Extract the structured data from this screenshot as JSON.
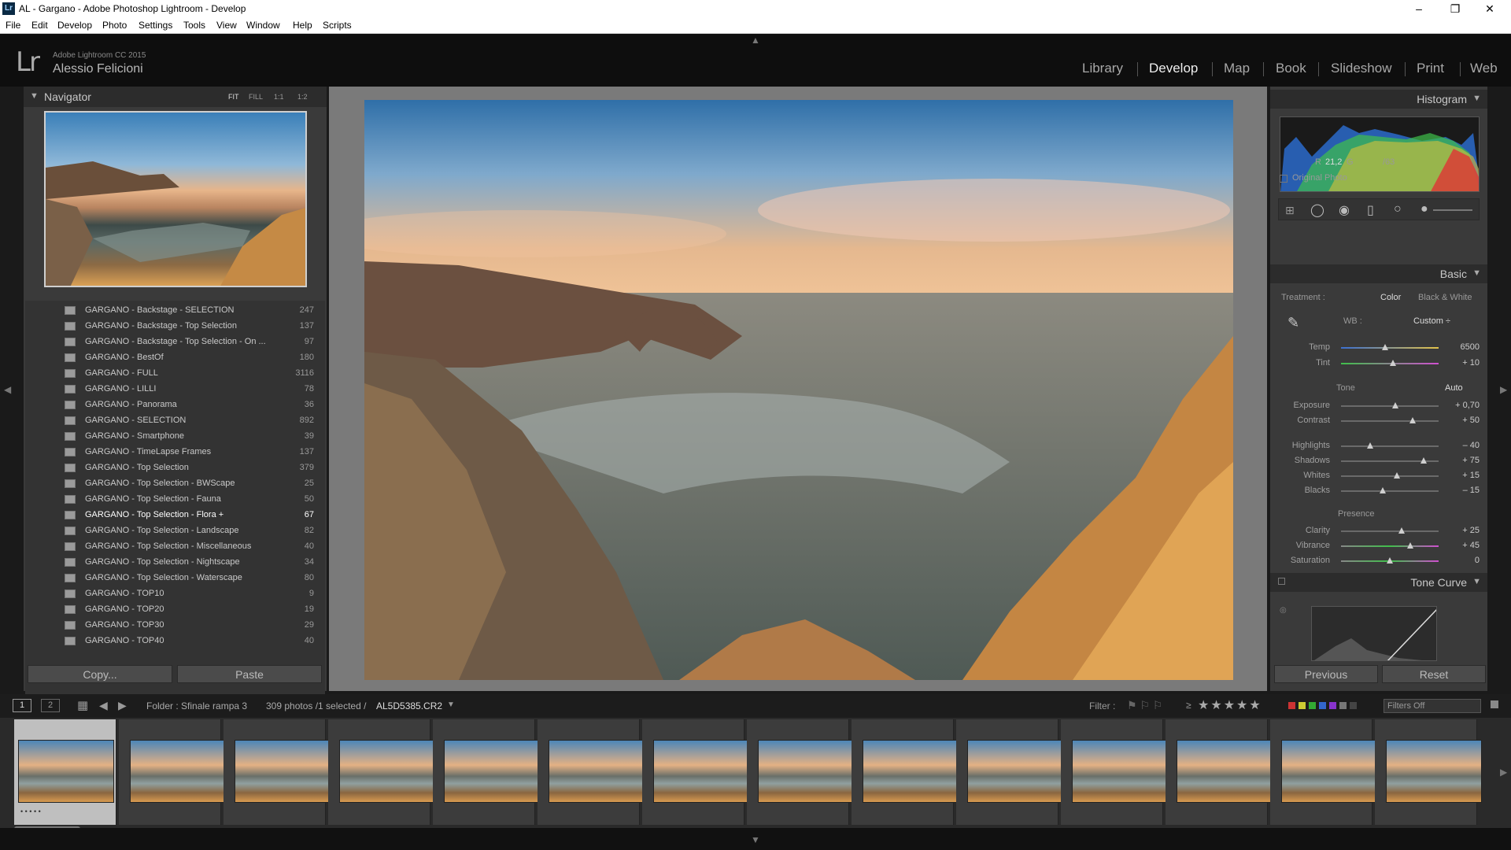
{
  "window": {
    "title": "AL - Gargano - Adobe Photoshop Lightroom - Develop",
    "icon": "Lr",
    "controls": {
      "minimize": "–",
      "maximize": "❐",
      "close": "✕"
    }
  },
  "menu": [
    "File",
    "Edit",
    "Develop",
    "Photo",
    "Settings",
    "Tools",
    "View",
    "Window",
    "Help",
    "Scripts"
  ],
  "header": {
    "logo": "Lr",
    "app_version": "Adobe Lightroom CC 2015",
    "user": "Alessio Felicioni",
    "modules": [
      "Library",
      "Develop",
      "Map",
      "Book",
      "Slideshow",
      "Print",
      "Web"
    ],
    "active_module": "Develop"
  },
  "navigator": {
    "title": "Navigator",
    "options": [
      "FIT",
      "FILL",
      "1:1",
      "1:2"
    ]
  },
  "collections": [
    {
      "name": "GARGANO - Backstage - SELECTION",
      "count": "247"
    },
    {
      "name": "GARGANO - Backstage - Top Selection",
      "count": "137"
    },
    {
      "name": "GARGANO - Backstage - Top Selection - On ...",
      "count": "97"
    },
    {
      "name": "GARGANO - BestOf",
      "count": "180"
    },
    {
      "name": "GARGANO - FULL",
      "count": "3116"
    },
    {
      "name": "GARGANO - LILLI",
      "count": "78"
    },
    {
      "name": "GARGANO - Panorama",
      "count": "36"
    },
    {
      "name": "GARGANO - SELECTION",
      "count": "892"
    },
    {
      "name": "GARGANO - Smartphone",
      "count": "39"
    },
    {
      "name": "GARGANO - TimeLapse Frames",
      "count": "137"
    },
    {
      "name": "GARGANO - Top Selection",
      "count": "379"
    },
    {
      "name": "GARGANO - Top Selection - BWScape",
      "count": "25"
    },
    {
      "name": "GARGANO - Top Selection - Fauna",
      "count": "50"
    },
    {
      "name": "GARGANO - Top Selection - Flora  +",
      "count": "67"
    },
    {
      "name": "GARGANO - Top Selection - Landscape",
      "count": "82"
    },
    {
      "name": "GARGANO - Top Selection - Miscellaneous",
      "count": "40"
    },
    {
      "name": "GARGANO - Top Selection - Nightscape",
      "count": "34"
    },
    {
      "name": "GARGANO - Top Selection - Waterscape",
      "count": "80"
    },
    {
      "name": "GARGANO - TOP10",
      "count": "9"
    },
    {
      "name": "GARGANO - TOP20",
      "count": "19"
    },
    {
      "name": "GARGANO - TOP30",
      "count": "29"
    },
    {
      "name": "GARGANO - TOP40",
      "count": "40"
    }
  ],
  "left_buttons": {
    "copy": "Copy...",
    "paste": "Paste"
  },
  "histogram": {
    "title": "Histogram",
    "readout_r_label": "R",
    "readout_r": "21,2",
    "readout_g_label": "G",
    "readout_b": "/63",
    "original_photo": "Original Photo"
  },
  "basic": {
    "title": "Basic",
    "treatment_label": "Treatment :",
    "treatment_color": "Color",
    "treatment_bw": "Black & White",
    "wb_label": "WB :",
    "wb_value": "Custom ÷",
    "tone_label": "Tone",
    "auto_label": "Auto",
    "presence_label": "Presence",
    "sliders": [
      {
        "label": "Temp",
        "value": "6500",
        "pos": 0.45
      },
      {
        "label": "Tint",
        "value": "+ 10",
        "pos": 0.53
      },
      {
        "label": "Exposure",
        "value": "+ 0,70",
        "pos": 0.56
      },
      {
        "label": "Contrast",
        "value": "+ 50",
        "pos": 0.73
      },
      {
        "label": "Highlights",
        "value": "– 40",
        "pos": 0.3
      },
      {
        "label": "Shadows",
        "value": "+ 75",
        "pos": 0.85
      },
      {
        "label": "Whites",
        "value": "+ 15",
        "pos": 0.57
      },
      {
        "label": "Blacks",
        "value": "– 15",
        "pos": 0.43
      },
      {
        "label": "Clarity",
        "value": "+ 25",
        "pos": 0.62
      },
      {
        "label": "Vibrance",
        "value": "+ 45",
        "pos": 0.71
      },
      {
        "label": "Saturation",
        "value": "0",
        "pos": 0.5
      }
    ]
  },
  "tone_curve": {
    "title": "Tone Curve"
  },
  "right_buttons": {
    "previous": "Previous",
    "reset": "Reset"
  },
  "filmbar": {
    "page1": "1",
    "page2": "2",
    "folder": "Folder : Sfinale rampa 3",
    "count": "309 photos /1 selected /",
    "filename": "AL5D5385.CR2",
    "filter_label": "Filter :",
    "stars_op": "≥",
    "stars": "★★★★★",
    "filters_off": "Filters Off"
  },
  "filmstrip": {
    "count": 14,
    "selected_rating": "• • • • •"
  }
}
